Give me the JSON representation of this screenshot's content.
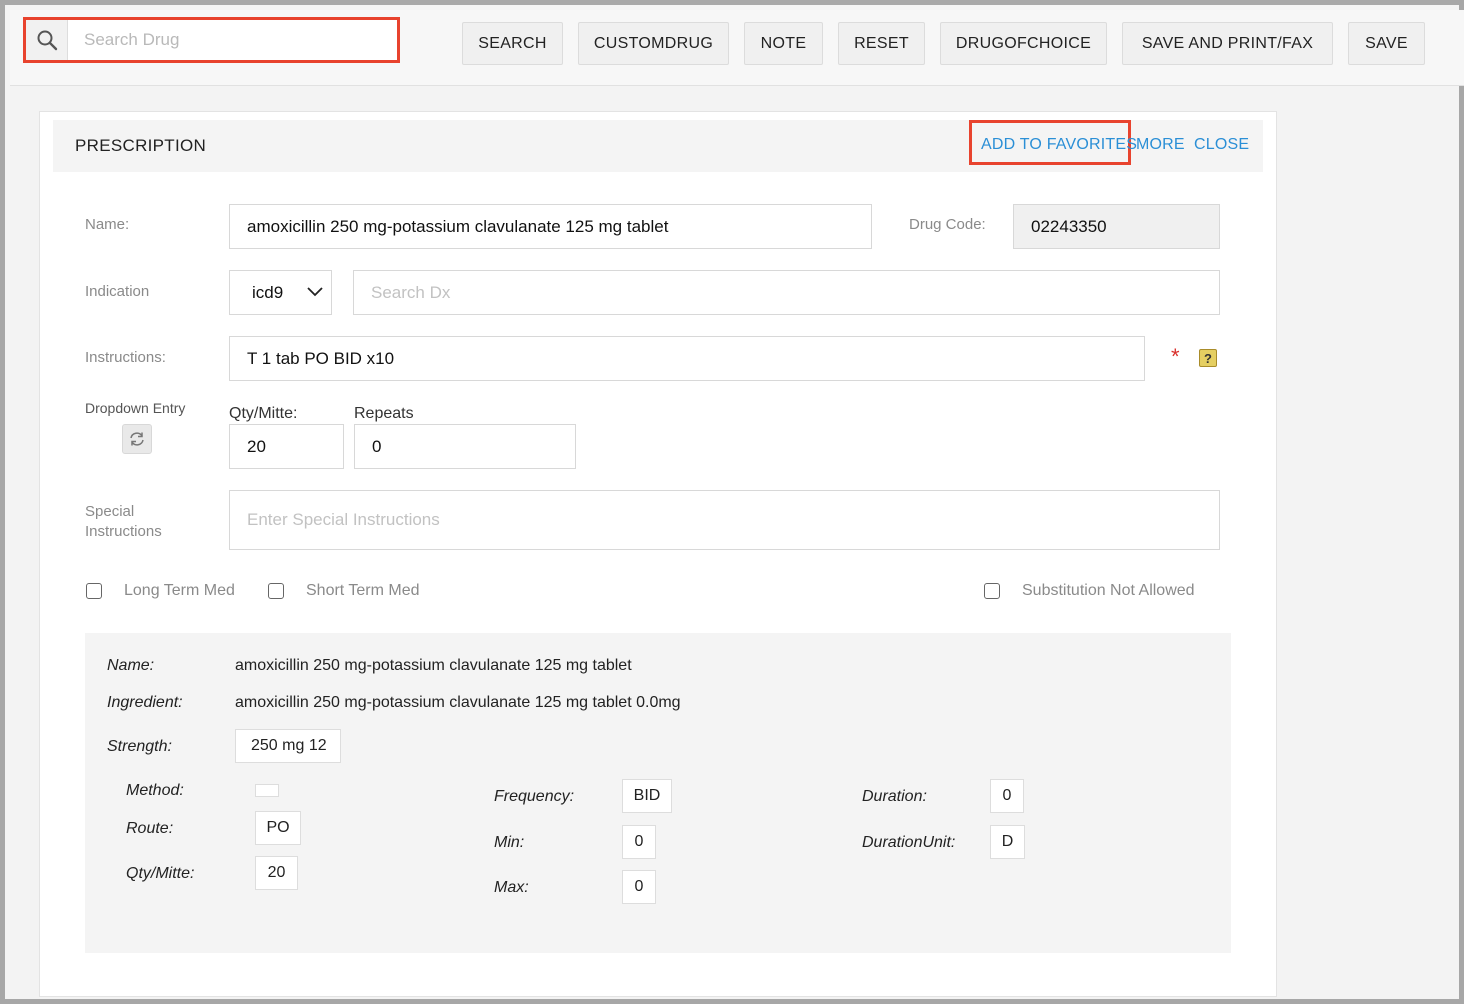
{
  "search": {
    "placeholder": "Search Drug",
    "icon": "search-icon"
  },
  "toolbar": {
    "search_label": "SEARCH",
    "customdrug_label": "CUSTOMDRUG",
    "note_label": "NOTE",
    "reset_label": "RESET",
    "drugofchoice_label": "DRUGOFCHOICE",
    "save_print_fax_label": "SAVE AND PRINT/FAX",
    "save_label": "SAVE"
  },
  "panel": {
    "title": "PRESCRIPTION",
    "add_to_favorites": "ADD TO FAVORITES",
    "more": "MORE",
    "close": "CLOSE"
  },
  "form": {
    "name_label": "Name:",
    "name_value": "amoxicillin 250 mg-potassium clavulanate 125 mg tablet",
    "drug_code_label": "Drug Code:",
    "drug_code_value": "02243350",
    "indication_label": "Indication",
    "indication_select": "icd9",
    "search_dx_placeholder": "Search Dx",
    "instructions_label": "Instructions:",
    "instructions_value": "T 1 tab PO BID x10",
    "required_marker": "*",
    "help_icon": "help-icon",
    "dropdown_entry_label": "Dropdown Entry",
    "qty_label": "Qty/Mitte:",
    "qty_value": "20",
    "repeats_label": "Repeats",
    "repeats_value": "0",
    "special_label_1": "Special",
    "special_label_2": "Instructions",
    "special_placeholder": "Enter Special Instructions",
    "long_term_label": "Long Term Med",
    "short_term_label": "Short Term Med",
    "substitution_label": "Substitution Not Allowed"
  },
  "detail": {
    "name_label": "Name:",
    "name_value": "amoxicillin 250 mg-potassium clavulanate 125 mg tablet",
    "ingredient_label": "Ingredient:",
    "ingredient_value": "amoxicillin 250 mg-potassium clavulanate 125 mg tablet 0.0mg",
    "strength_label": "Strength:",
    "strength_value": "250 mg 12",
    "method_label": "Method:",
    "method_value": "",
    "route_label": "Route:",
    "route_value": "PO",
    "qty_label": "Qty/Mitte:",
    "qty_value": "20",
    "frequency_label": "Frequency:",
    "frequency_value": "BID",
    "min_label": "Min:",
    "min_value": "0",
    "max_label": "Max:",
    "max_value": "0",
    "duration_label": "Duration:",
    "duration_value": "0",
    "duration_unit_label": "DurationUnit:",
    "duration_unit_value": "D"
  },
  "colors": {
    "highlight": "#e8432e",
    "link": "#2b8fd6",
    "required": "#d9302c"
  }
}
